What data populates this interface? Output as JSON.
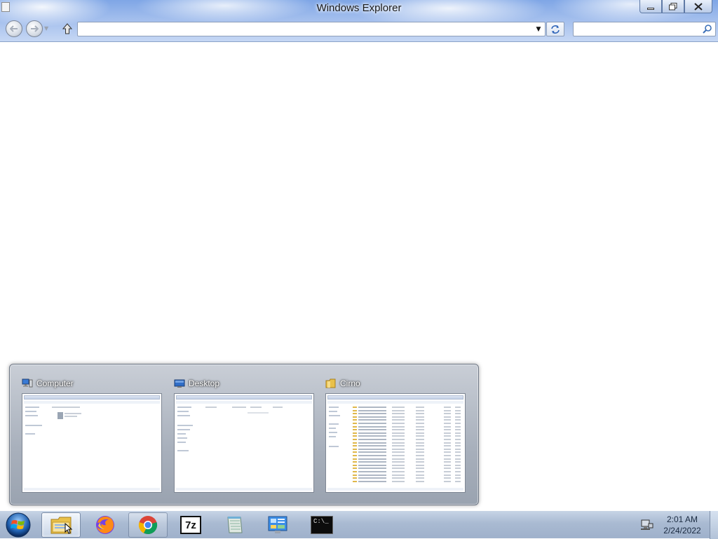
{
  "window": {
    "title": "Windows Explorer",
    "address": "",
    "search_placeholder": ""
  },
  "peek": {
    "thumbnails": [
      {
        "title": "Computer",
        "icon": "computer-icon"
      },
      {
        "title": "Desktop",
        "icon": "desktop-icon"
      },
      {
        "title": "Cirno",
        "icon": "folder-icon"
      }
    ]
  },
  "taskbar": {
    "start_icon": "windows-logo-icon",
    "buttons": [
      {
        "name": "windows-explorer",
        "icon": "folder-icon",
        "state": "active"
      },
      {
        "name": "firefox",
        "icon": "firefox-icon",
        "state": "pinned"
      },
      {
        "name": "chrome",
        "icon": "chrome-icon",
        "state": "running"
      },
      {
        "name": "7-zip",
        "icon": "7zip-icon",
        "state": "pinned"
      },
      {
        "name": "notepad",
        "icon": "notepad-icon",
        "state": "pinned"
      },
      {
        "name": "control-panel",
        "icon": "control-panel-icon",
        "state": "pinned"
      },
      {
        "name": "command-prompt",
        "icon": "cmd-icon",
        "state": "pinned"
      }
    ],
    "cmd_label": "C:\\_",
    "sevenzip_label": "7z",
    "clock": {
      "time": "2:01 AM",
      "date": "2/24/2022"
    }
  },
  "colors": {
    "title_gradient_top": "#7fa6e6",
    "taskbar": "#a9bad2",
    "peek_bg": "#a8b0bc"
  }
}
